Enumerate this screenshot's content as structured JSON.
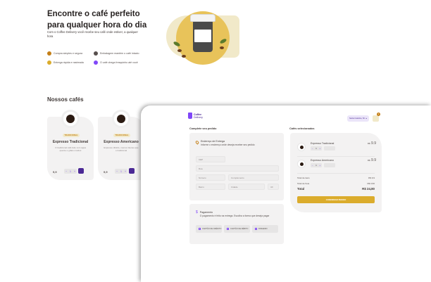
{
  "hero": {
    "title_line1": "Encontre o café perfeito",
    "title_line2": "para qualquer hora do dia",
    "subtitle": "Com o Coffee Delivery você recebe seu café onde estiver, a qualquer hora",
    "features": [
      {
        "label": "Compra simples e segura",
        "color": "#c47f17"
      },
      {
        "label": "Embalagem mantém o café intacto",
        "color": "#574f4d"
      },
      {
        "label": "Entrega rápida e rastreada",
        "color": "#dbac2c"
      },
      {
        "label": "O café chega fresquinho até você",
        "color": "#8047f8"
      }
    ]
  },
  "catalog": {
    "title": "Nossos cafés",
    "cards": [
      {
        "tag": "TRADICIONAL",
        "name": "Expresso Tradicional",
        "desc": "O tradicional café feito com água quente e grãos moídos",
        "price": "9,9",
        "qty": "1"
      },
      {
        "tag": "TRADICIONAL",
        "name": "Expresso Americano",
        "desc": "Expresso diluído, menos intenso que o tradicional",
        "price": "9,9",
        "qty": "1"
      }
    ]
  },
  "checkout": {
    "brand": {
      "name": "Coffee",
      "sub": "Delivery"
    },
    "location": "Santa Catarina, SC",
    "cart_count": "2",
    "left_heading": "Complete seu pedido",
    "right_heading": "Cafés selecionados",
    "address": {
      "title": "Endereço de Entrega",
      "desc": "Informe o endereço onde deseja receber seu pedido",
      "fields": {
        "cep": "CEP",
        "rua": "Rua",
        "numero": "Número",
        "complemento": "Complemento",
        "bairro": "Bairro",
        "cidade": "Cidade",
        "uf": "UF"
      }
    },
    "payment": {
      "title": "Pagamento",
      "desc": "O pagamento é feito na entrega. Escolha a forma que deseja pagar",
      "options": [
        "CARTÃO DE CRÉDITO",
        "CARTÃO DE DÉBITO",
        "DINHEIRO"
      ]
    },
    "items": [
      {
        "name": "Expresso Tradicional",
        "qty": "1",
        "currency": "R$",
        "price": "9.9"
      },
      {
        "name": "Expresso Americano",
        "qty": "1",
        "currency": "R$",
        "price": "9.9"
      }
    ],
    "totals": {
      "items_label": "Total de itens",
      "items_value": "R$ 9,9",
      "delivery_label": "Total de frete",
      "delivery_value": "R$ 3,50",
      "total_label": "Total",
      "total_value": "R$ 24,80"
    },
    "confirm_label": "CONFIRMAR PEDIDO"
  }
}
